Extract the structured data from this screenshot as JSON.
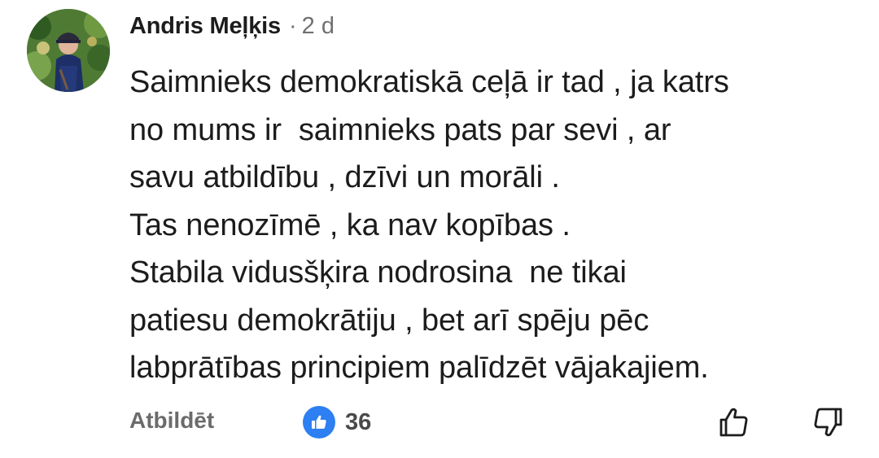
{
  "comment": {
    "author": "Andris Meļķis",
    "separator": "·",
    "time": "2 d",
    "lines": [
      "Saimnieks demokratiskā ceļā ir tad , ja katrs",
      "no mums ir  saimnieks pats par sevi , ar",
      "savu atbildību , dzīvi un morāli .",
      "Tas nenozīmē , ka nav kopības .",
      "Stabila vidusšķira nodrosina  ne tikai",
      "patiesu demokrātiju , bet arī spēju pēc",
      "labprātības principiem palīdzēt vājakajiem."
    ]
  },
  "actions": {
    "reply_label": "Atbildēt",
    "like_count": "36",
    "like_icon": "thumbs-up-badge-icon",
    "thumb_up_icon": "thumbs-up-outline-icon",
    "thumb_down_icon": "thumbs-down-outline-icon"
  },
  "colors": {
    "like_badge": "#2d7ff2",
    "text_primary": "#1c1c1c",
    "text_secondary": "#707070"
  }
}
